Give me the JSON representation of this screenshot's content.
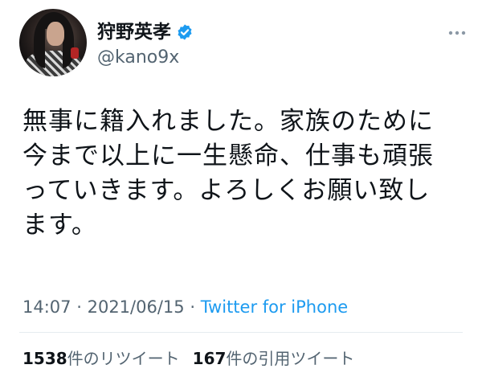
{
  "author": {
    "display_name": "狩野英孝",
    "handle": "@kano9x",
    "verified_badge_icon": "verified-badge-icon",
    "more_icon": "more-horizontal-icon"
  },
  "tweet": {
    "text": "無事に籍入れました。家族のために\n今まで以上に一生懸命、仕事も頑張\nっていきます。よろしくお願い致し\nます。",
    "time": "14:07",
    "separator": "·",
    "date": "2021/06/15",
    "source": "Twitter for iPhone"
  },
  "stats": {
    "retweets_count": "1538",
    "retweets_label": "件のリツイート",
    "quotes_count": "167",
    "quotes_label": "件の引用ツイート"
  },
  "colors": {
    "link": "#1d9bf0",
    "secondary_text": "#536471",
    "primary_text": "#0f1419",
    "verified": "#1d9bf0"
  }
}
